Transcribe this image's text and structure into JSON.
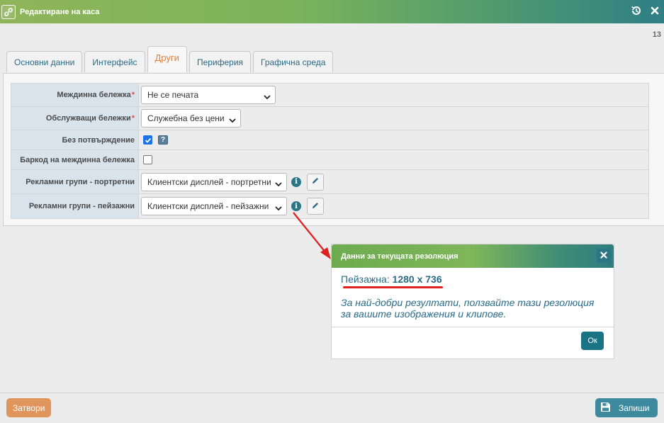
{
  "window": {
    "title": "Редактиране на каса",
    "page_number": "13",
    "icons": {
      "app": "link-icon",
      "history": "history-icon",
      "close": "close-icon"
    }
  },
  "tabs": [
    {
      "label": "Основни данни",
      "active": false
    },
    {
      "label": "Интерфейс",
      "active": false
    },
    {
      "label": "Други",
      "active": true
    },
    {
      "label": "Периферия",
      "active": false
    },
    {
      "label": "Графична среда",
      "active": false
    }
  ],
  "form": {
    "intermediate_receipt": {
      "label": "Междинна бележка",
      "required_mark": "*",
      "value": "Не се печата"
    },
    "service_receipts": {
      "label": "Обслужващи бележки",
      "required_mark": "*",
      "value": "Служебна без цени"
    },
    "no_confirmation": {
      "label": "Без потвърждение",
      "checked": true,
      "help": "?"
    },
    "barcode_intermediate": {
      "label": "Баркод на междинна бележка",
      "checked": false
    },
    "ad_groups_portrait": {
      "label": "Рекламни групи - портретни",
      "value": "Клиентски дисплей - портретни",
      "info": "i"
    },
    "ad_groups_landscape": {
      "label": "Рекламни групи - пейзажни",
      "value": "Клиентски дисплей - пейзажни",
      "info": "i"
    }
  },
  "modal": {
    "title": "Данни за текущата резолюция",
    "resolution_label": "Пейзажна:",
    "resolution_value": "1280 x 736",
    "hint": "За най-добри резултати, ползвайте тази резолюция за вашите изображения и клипове.",
    "ok_label": "Ок"
  },
  "footer": {
    "close_label": "Затвори",
    "save_label": "Запиши"
  },
  "colors": {
    "accent": "#2a6b87",
    "active_tab": "#e0803a",
    "close_button": "#e0955c",
    "save_button": "#3d8a9e",
    "annotation": "#e02020"
  }
}
